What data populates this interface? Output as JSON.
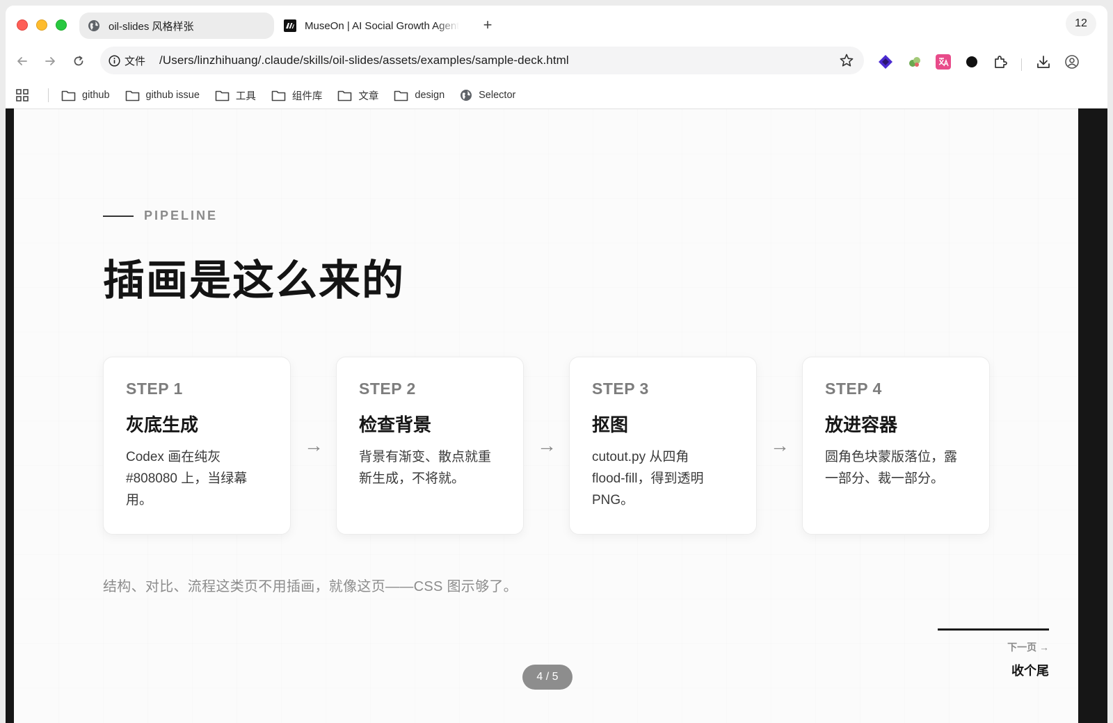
{
  "browser": {
    "tabs": [
      {
        "title": "oil-slides 风格样张",
        "icon": "globe-icon",
        "active": true
      },
      {
        "title": "MuseOn | AI Social Growth Agent",
        "icon": "museon-logo-icon",
        "active": false
      }
    ],
    "new_tab_label": "+",
    "tab_count": "12",
    "omnibox": {
      "info_label": "文件",
      "url": "/Users/linzhihuang/.claude/skills/oil-slides/assets/examples/sample-deck.html"
    },
    "bookmarks": [
      {
        "label": "github",
        "icon": "folder-icon"
      },
      {
        "label": "github issue",
        "icon": "folder-icon"
      },
      {
        "label": "工具",
        "icon": "folder-icon"
      },
      {
        "label": "组件库",
        "icon": "folder-icon"
      },
      {
        "label": "文章",
        "icon": "folder-icon"
      },
      {
        "label": "design",
        "icon": "folder-icon"
      },
      {
        "label": "Selector",
        "icon": "globe-icon"
      }
    ],
    "colors": {
      "accent_red": "#fe5f57",
      "accent_yellow": "#febc2e",
      "accent_green": "#28c840"
    }
  },
  "slide": {
    "eyebrow": "PIPELINE",
    "title": "插画是这么来的",
    "steps": [
      {
        "label": "STEP 1",
        "title": "灰底生成",
        "desc_lines": [
          "Codex 画在纯灰",
          "#808080 上，当绿幕",
          "用。"
        ]
      },
      {
        "label": "STEP 2",
        "title": "检查背景",
        "desc_lines": [
          "背景有渐变、散点就重",
          "新生成，不将就。"
        ]
      },
      {
        "label": "STEP 3",
        "title": "抠图",
        "desc_lines": [
          "cutout.py 从四角",
          "flood-fill，得到透明",
          "PNG。"
        ]
      },
      {
        "label": "STEP 4",
        "title": "放进容器",
        "desc_lines": [
          "圆角色块蒙版落位，露",
          "一部分、裁一部分。"
        ]
      }
    ],
    "arrow": "→",
    "footnote": "结构、对比、流程这类页不用插画，就像这页——CSS 图示够了。",
    "next": {
      "label": "下一页 →",
      "title": "收个尾"
    },
    "pager": "4 / 5"
  }
}
